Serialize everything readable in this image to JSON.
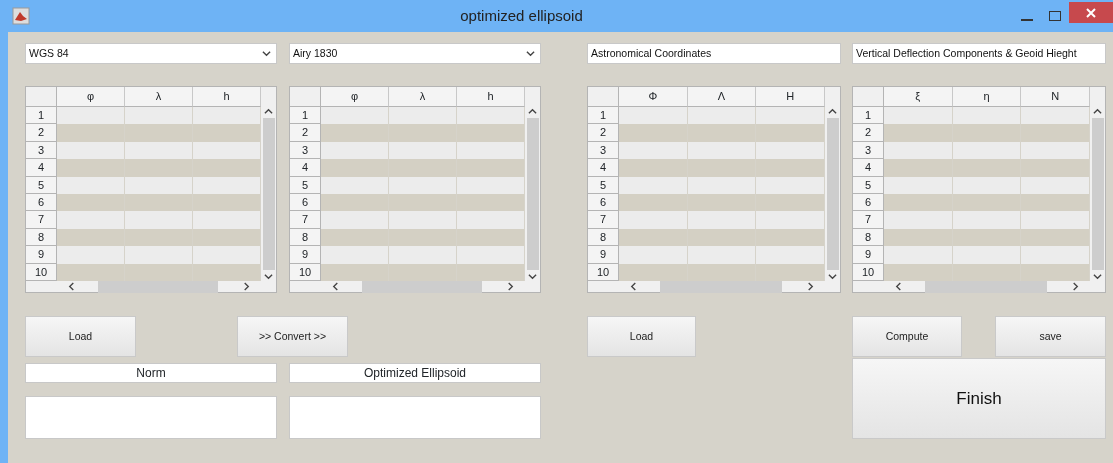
{
  "window": {
    "title": "optimized ellipsoid"
  },
  "headers": [
    {
      "kind": "dropdown",
      "value": "WGS 84"
    },
    {
      "kind": "dropdown",
      "value": "Airy 1830"
    },
    {
      "kind": "field",
      "value": "Astronomical Coordinates"
    },
    {
      "kind": "field",
      "value": "Vertical Deflection Components & Geoid Hieght"
    }
  ],
  "tables": [
    {
      "columns": [
        "φ",
        "λ",
        "h"
      ],
      "rows": [
        "1",
        "2",
        "3",
        "4",
        "5",
        "6",
        "7",
        "8",
        "9",
        "10"
      ]
    },
    {
      "columns": [
        "φ",
        "λ",
        "h"
      ],
      "rows": [
        "1",
        "2",
        "3",
        "4",
        "5",
        "6",
        "7",
        "8",
        "9",
        "10"
      ]
    },
    {
      "columns": [
        "Φ",
        "Λ",
        "H"
      ],
      "rows": [
        "1",
        "2",
        "3",
        "4",
        "5",
        "6",
        "7",
        "8",
        "9",
        "10"
      ]
    },
    {
      "columns": [
        "ξ",
        "η",
        "N"
      ],
      "rows": [
        "1",
        "2",
        "3",
        "4",
        "5",
        "6",
        "7",
        "8",
        "9",
        "10"
      ]
    }
  ],
  "buttons": [
    "Load",
    ">> Convert >>",
    "Load",
    "Compute",
    "save"
  ],
  "outputs": [
    {
      "label": "Norm"
    },
    {
      "label": "Optimized Ellipsoid"
    }
  ],
  "finish_button": "Finish"
}
